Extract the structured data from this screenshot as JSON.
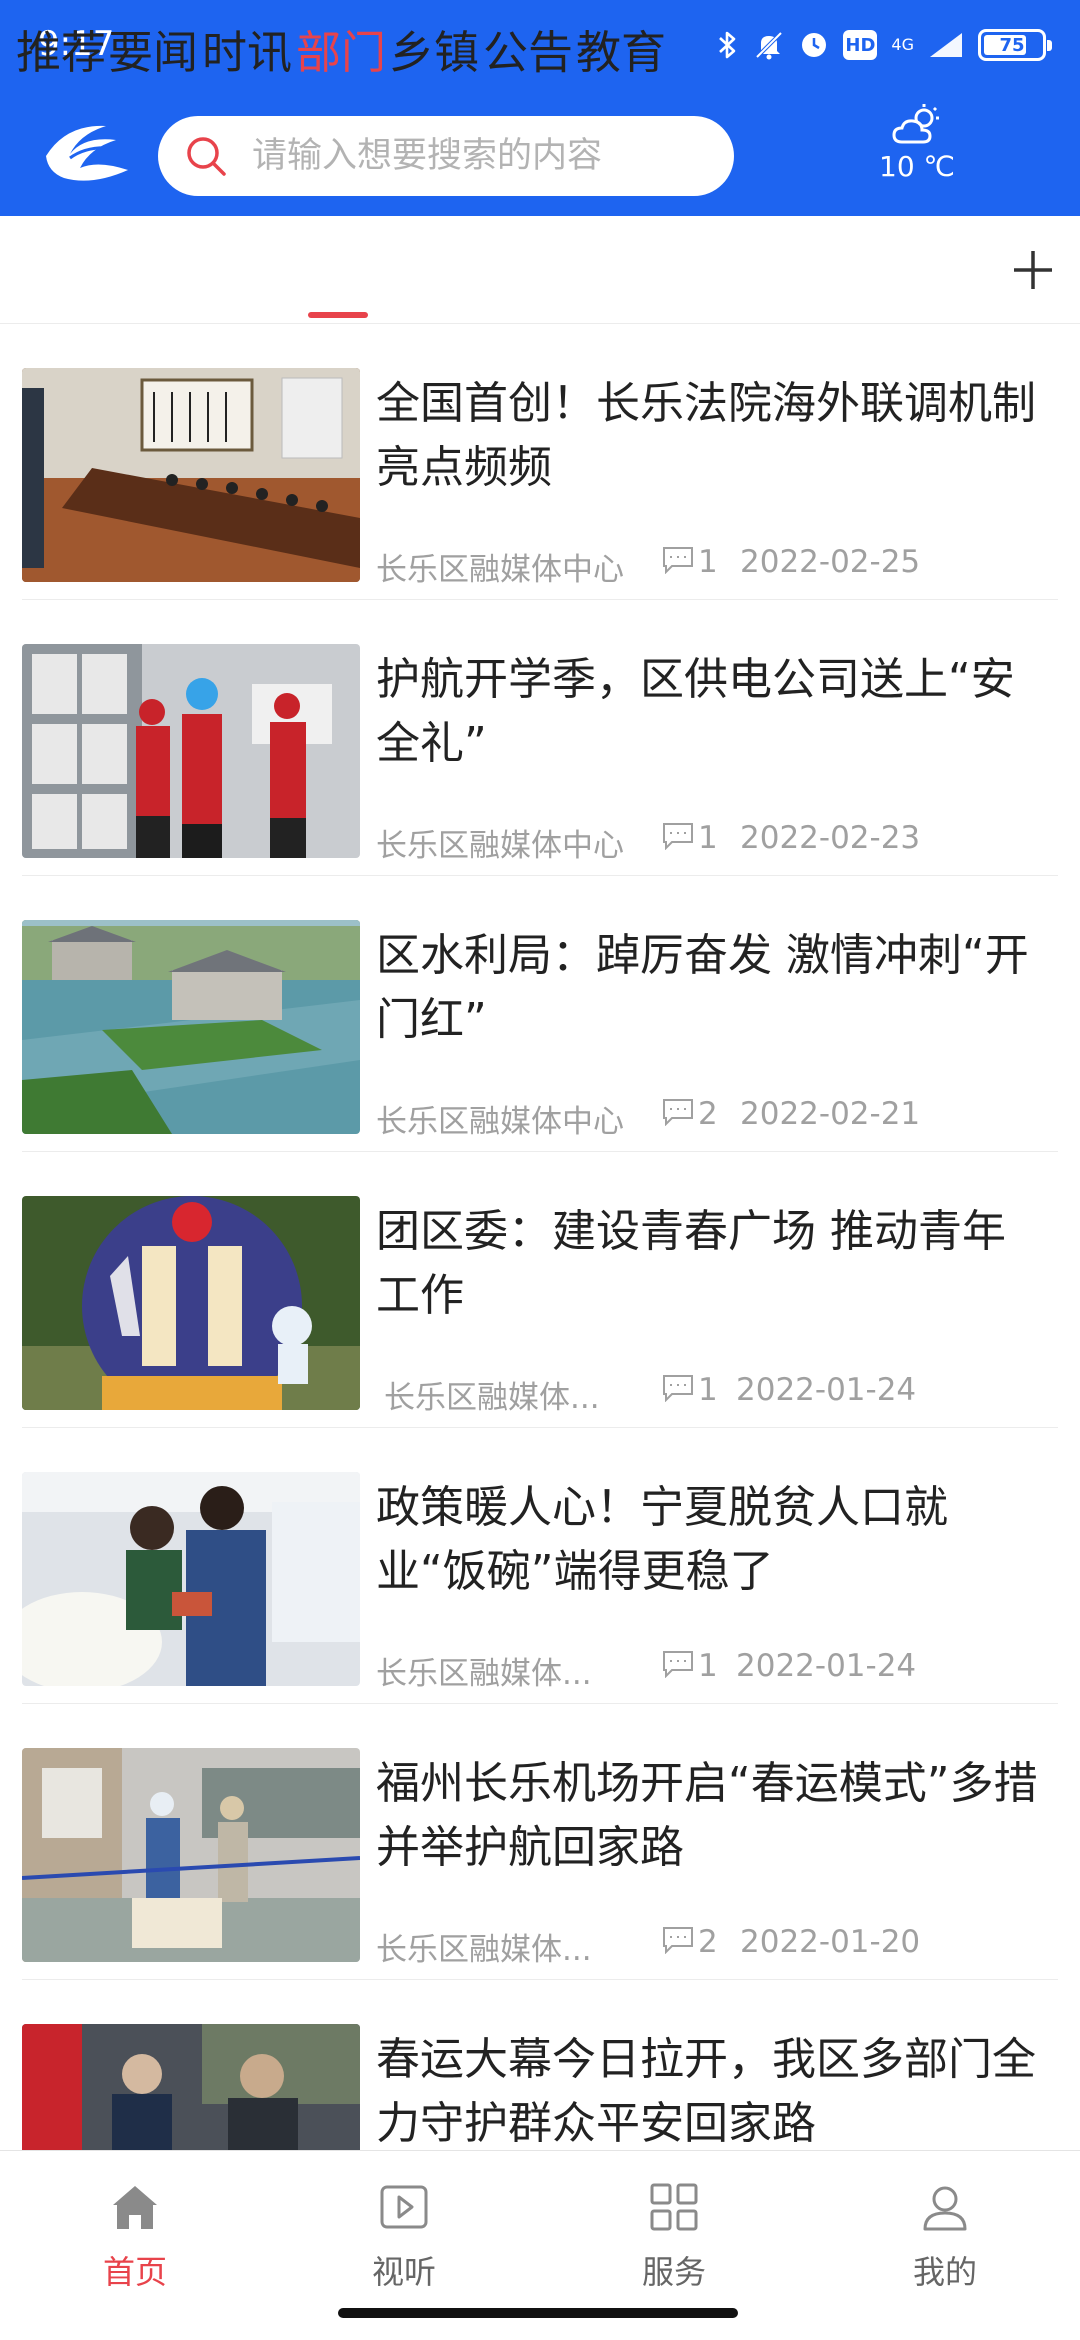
{
  "status_bar": {
    "time": "9:17",
    "network": "4G",
    "hd_badge": "HD",
    "battery": "75",
    "battery_level": 0.75
  },
  "header": {
    "search_placeholder": "请输入想要搜索的内容",
    "weather_icon": "partly-cloudy-icon",
    "temperature": "10 ℃"
  },
  "tabs": [
    {
      "label": "推荐",
      "active": false
    },
    {
      "label": "要闻",
      "active": false
    },
    {
      "label": "时讯",
      "active": false
    },
    {
      "label": "部门",
      "active": true
    },
    {
      "label": "乡镇",
      "active": false
    },
    {
      "label": "公告",
      "active": false
    },
    {
      "label": "教育",
      "active": false
    }
  ],
  "articles": [
    {
      "title": "全国首创！长乐法院海外联调机制亮点频频",
      "source": "长乐区融媒体中心",
      "comments": "1",
      "date": "2022-02-25"
    },
    {
      "title": "护航开学季，区供电公司送上“安全礼”",
      "source": "长乐区融媒体中心",
      "comments": "1",
      "date": "2022-02-23"
    },
    {
      "title": "区水利局：踔厉奋发 激情冲刺“开门红”",
      "source": "长乐区融媒体中心",
      "comments": "2",
      "date": "2022-02-21"
    },
    {
      "title": "团区委：建设青春广场 推动青年工作",
      "source": "长乐区融媒体...",
      "comments": "1",
      "date": "2022-01-24"
    },
    {
      "title": "政策暖人心！宁夏脱贫人口就业“饭碗”端得更稳了",
      "source": "长乐区融媒体...",
      "comments": "1",
      "date": "2022-01-24"
    },
    {
      "title": "福州长乐机场开启“春运模式”多措并举护航回家路",
      "source": "长乐区融媒体...",
      "comments": "2",
      "date": "2022-01-20"
    },
    {
      "title": "春运大幕今日拉开，我区多部门全力守护群众平安回家路",
      "source": "",
      "comments": "",
      "date": ""
    }
  ],
  "bottom_nav": [
    {
      "label": "首页",
      "icon": "home-icon",
      "active": true
    },
    {
      "label": "视听",
      "icon": "play-icon",
      "active": false
    },
    {
      "label": "服务",
      "icon": "grid-icon",
      "active": false
    },
    {
      "label": "我的",
      "icon": "user-icon",
      "active": false
    }
  ],
  "colors": {
    "brand_blue": "#1e64f0",
    "accent_red": "#e8434b",
    "meta_gray": "#a0a0a0"
  }
}
